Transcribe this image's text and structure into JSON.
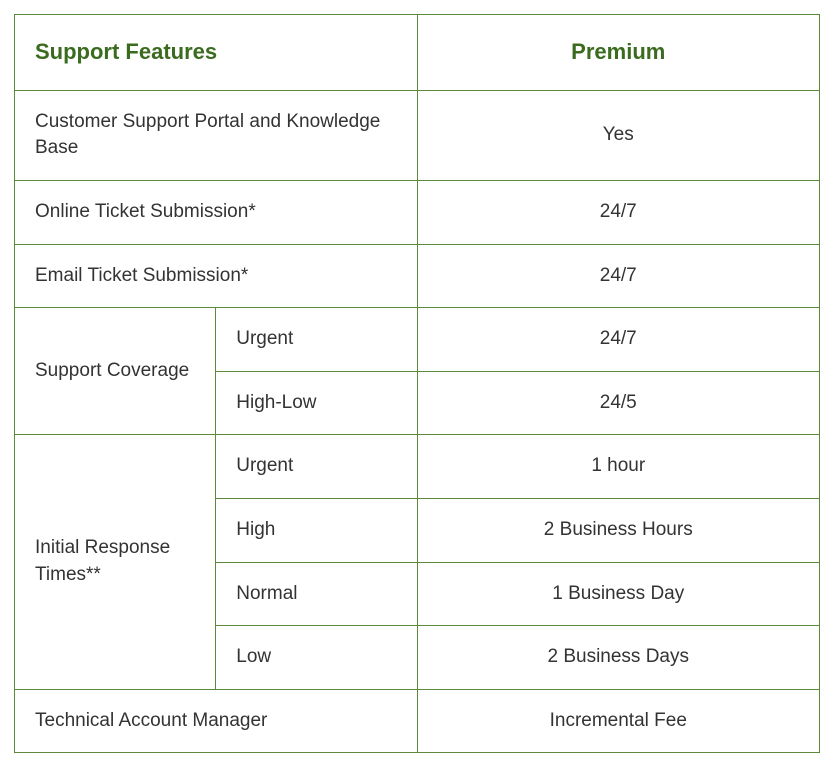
{
  "headers": {
    "features": "Support Features",
    "premium": "Premium"
  },
  "rows": {
    "portal": {
      "label": "Customer Support Portal and Knowledge Base",
      "value": "Yes"
    },
    "online_ticket": {
      "label": "Online Ticket Submission*",
      "value": "24/7"
    },
    "email_ticket": {
      "label": "Email Ticket Submission*",
      "value": "24/7"
    },
    "support_coverage": {
      "label": "Support Coverage",
      "urgent": {
        "label": "Urgent",
        "value": "24/7"
      },
      "high_low": {
        "label": "High-Low",
        "value": "24/5"
      }
    },
    "response_times": {
      "label": "Initial Response Times**",
      "urgent": {
        "label": "Urgent",
        "value": "1 hour"
      },
      "high": {
        "label": "High",
        "value": "2 Business Hours"
      },
      "normal": {
        "label": "Normal",
        "value": "1 Business Day"
      },
      "low": {
        "label": "Low",
        "value": "2 Business Days"
      }
    },
    "tam": {
      "label": "Technical Account Manager",
      "value": "Incremental Fee"
    }
  }
}
